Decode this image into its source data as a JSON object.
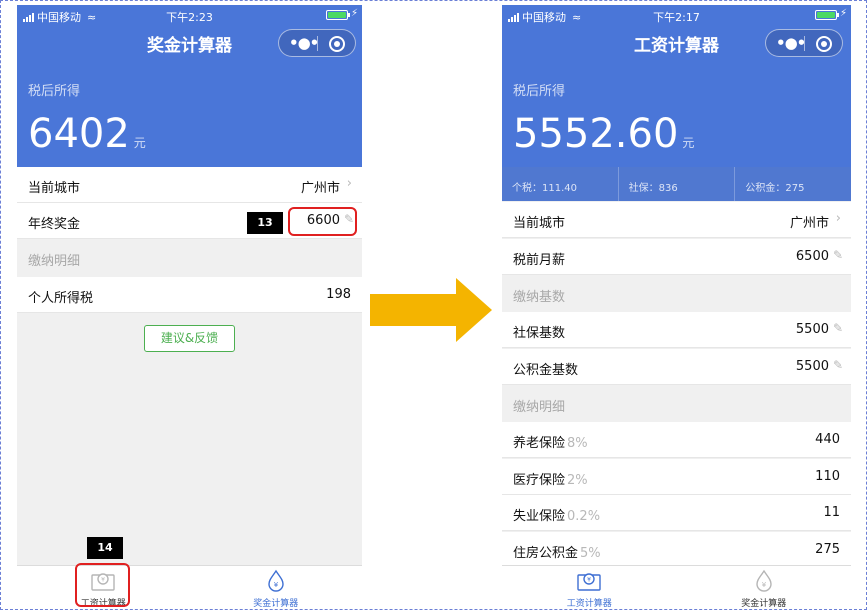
{
  "status_bar": {
    "carrier": "中国移动",
    "time_left": "下午2:23",
    "time_right": "下午2:17"
  },
  "left_screen": {
    "title": "奖金计算器",
    "hero_label": "税后所得",
    "hero_amount": "6402",
    "hero_unit": "元",
    "rows": {
      "city_label": "当前城市",
      "city_value": "广州市",
      "bonus_label": "年终奖金",
      "bonus_value": "6600",
      "detail_header": "缴纳明细",
      "tax_label": "个人所得税",
      "tax_value": "198"
    },
    "feedback_label": "建议&反馈",
    "annotations": {
      "bonus_marker": "13",
      "tab_marker": "14"
    },
    "tabs": {
      "salary": "工资计算器",
      "bonus": "奖金计算器"
    }
  },
  "right_screen": {
    "title": "工资计算器",
    "hero_label": "税后所得",
    "hero_amount": "5552.60",
    "hero_unit": "元",
    "deductions": {
      "tax": "个税：111.40",
      "social": "社保：836",
      "fund": "公积金：275"
    },
    "rows": {
      "city_label": "当前城市",
      "city_value": "广州市",
      "salary_label": "税前月薪",
      "salary_value": "6500",
      "base_header": "缴纳基数",
      "social_base_label": "社保基数",
      "social_base_value": "5500",
      "fund_base_label": "公积金基数",
      "fund_base_value": "5500",
      "detail_header": "缴纳明细",
      "pension_label": "养老保险",
      "pension_pct": "8%",
      "pension_value": "440",
      "medical_label": "医疗保险",
      "medical_pct": "2%",
      "medical_value": "110",
      "unemployment_label": "失业保险",
      "unemployment_pct": "0.2%",
      "unemployment_value": "11",
      "housing_label": "住房公积金",
      "housing_pct": "5%",
      "housing_value": "275"
    },
    "tabs": {
      "salary": "工资计算器",
      "bonus": "奖金计算器"
    }
  },
  "colors": {
    "header_blue": "#4a76d8",
    "deduction_blue": "#5078d0",
    "accent_green": "#4caf50",
    "highlight_red": "#e02020",
    "arrow_orange": "#f4b400",
    "tab_active": "#3e6fd3"
  },
  "icons": {
    "chevron": "chevron-right-icon",
    "edit": "pencil-icon",
    "salary_tab": "salary-card-icon",
    "bonus_tab": "money-drop-icon"
  }
}
